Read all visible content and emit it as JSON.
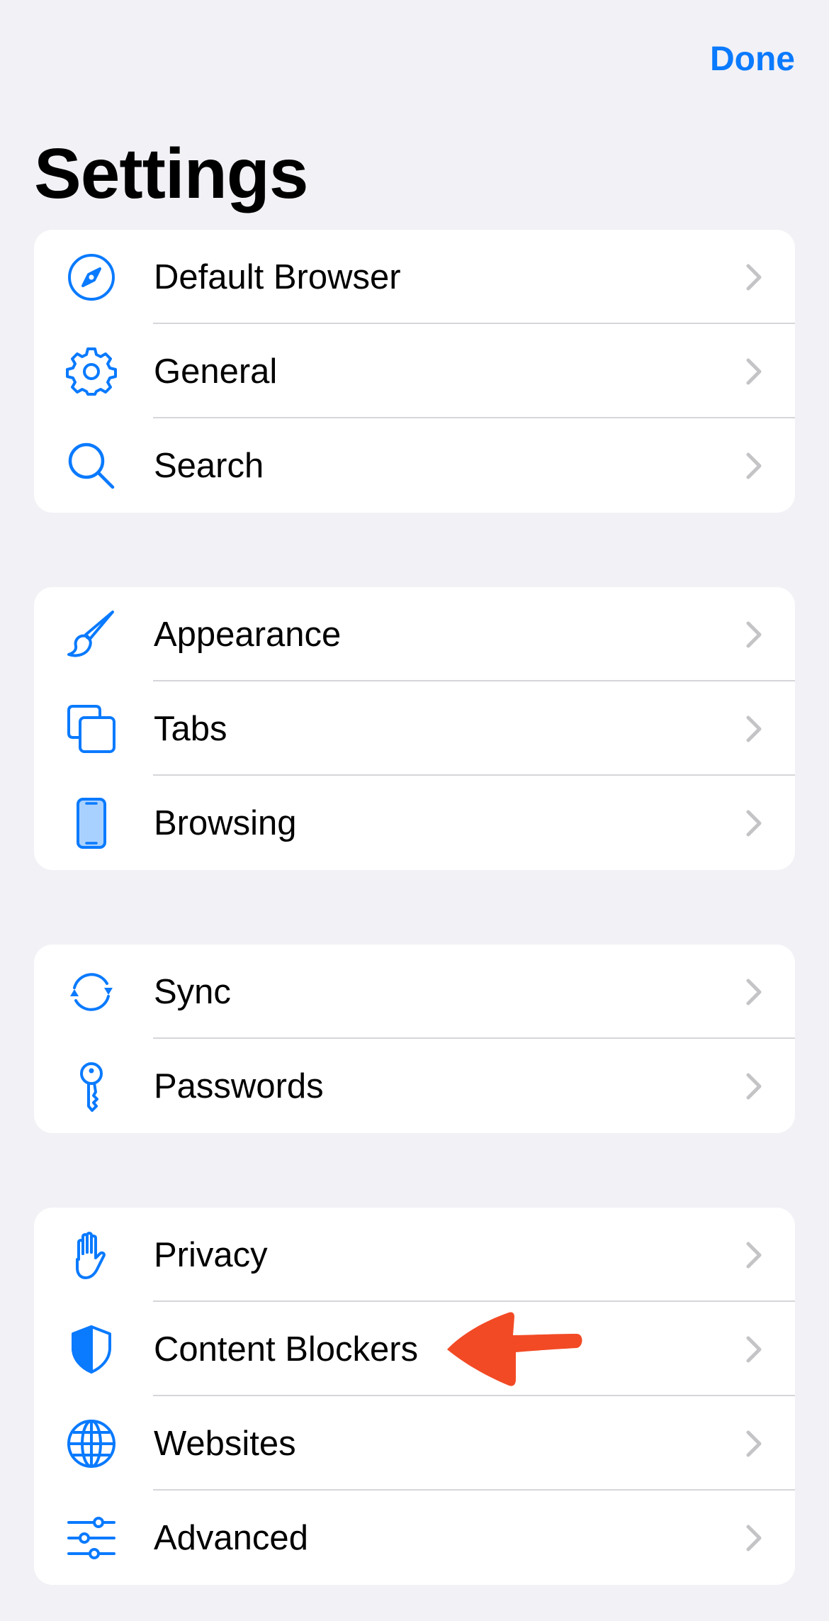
{
  "header": {
    "done_label": "Done",
    "title": "Settings"
  },
  "colors": {
    "accent": "#0a7aff",
    "background": "#f1f1f6",
    "chevron": "#c4c4c7",
    "annotation_arrow": "#f24a25"
  },
  "groups": [
    {
      "items": [
        {
          "label": "Default Browser",
          "icon": "compass-icon"
        },
        {
          "label": "General",
          "icon": "gear-icon"
        },
        {
          "label": "Search",
          "icon": "magnifier-icon"
        }
      ]
    },
    {
      "items": [
        {
          "label": "Appearance",
          "icon": "paintbrush-icon"
        },
        {
          "label": "Tabs",
          "icon": "tabs-icon"
        },
        {
          "label": "Browsing",
          "icon": "phone-icon"
        }
      ]
    },
    {
      "items": [
        {
          "label": "Sync",
          "icon": "sync-icon"
        },
        {
          "label": "Passwords",
          "icon": "key-icon"
        }
      ]
    },
    {
      "items": [
        {
          "label": "Privacy",
          "icon": "hand-icon"
        },
        {
          "label": "Content Blockers",
          "icon": "shield-icon"
        },
        {
          "label": "Websites",
          "icon": "globe-icon"
        },
        {
          "label": "Advanced",
          "icon": "sliders-icon"
        }
      ]
    }
  ],
  "annotation": {
    "type": "red-arrow",
    "points_to": "Content Blockers"
  }
}
